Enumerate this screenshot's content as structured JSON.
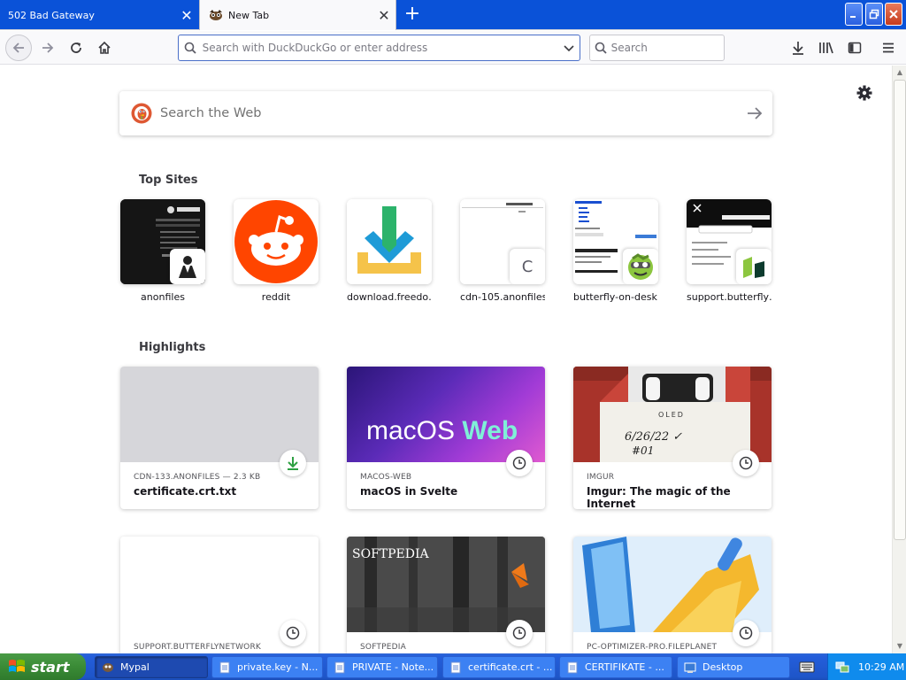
{
  "browser": {
    "tabs": [
      {
        "title": "502 Bad Gateway",
        "active": false
      },
      {
        "title": "New Tab",
        "active": true
      }
    ],
    "window_controls": {
      "minimize": "minimize",
      "maximize": "restore",
      "close": "close"
    }
  },
  "toolbar": {
    "url_placeholder": "Search with DuckDuckGo or enter address",
    "search_placeholder": "Search"
  },
  "newtab": {
    "web_search_placeholder": "Search the Web",
    "top_sites_title": "Top Sites",
    "top_sites": [
      {
        "label": "anonfiles"
      },
      {
        "label": "reddit"
      },
      {
        "label": "download.freedo…"
      },
      {
        "label": "cdn-105.anonfiles",
        "badge_letter": "C"
      },
      {
        "label": "butterfly-on-desk…"
      },
      {
        "label": "support.butterfly…"
      }
    ],
    "highlights_title": "Highlights",
    "highlights": [
      {
        "source": "CDN-133.ANONFILES — 2.3 KB",
        "title": "certificate.crt.txt",
        "icon": "download-icon",
        "image_text": ""
      },
      {
        "source": "MACOS-WEB",
        "title": "macOS in Svelte",
        "icon": "clock-icon",
        "image_text_1": "macOS",
        "image_text_2": "Web"
      },
      {
        "source": "IMGUR",
        "title": "Imgur: The magic of the Internet",
        "icon": "clock-icon",
        "image_text_1": "OLED",
        "image_text_2": "6/26/22 ✓",
        "image_text_3": "#01"
      },
      {
        "source": "SUPPORT.BUTTERFLYNETWORK",
        "title": "",
        "icon": "clock-icon"
      },
      {
        "source": "SOFTPEDIA",
        "title": "",
        "icon": "clock-icon",
        "image_text_1": "SOFTPEDIA"
      },
      {
        "source": "PC-OPTIMIZER-PRO.FILEPLANET",
        "title": "",
        "icon": "clock-icon"
      }
    ]
  },
  "taskbar": {
    "start_label": "start",
    "tasks": [
      {
        "label": "Mypal",
        "active": true
      },
      {
        "label": "private.key - N...",
        "active": false
      },
      {
        "label": "PRIVATE - Note...",
        "active": false
      },
      {
        "label": "certificate.crt - ...",
        "active": false
      },
      {
        "label": "CERTIFIKATE - ...",
        "active": false
      },
      {
        "label": "Desktop",
        "active": false
      }
    ],
    "clock": "10:29 AM"
  },
  "colors": {
    "titlebar": "#0a52d8",
    "taskbar": "#245edb",
    "start_green": "#3a8b36",
    "tray": "#0f8bed",
    "reddit": "#ff4500",
    "macos_purple": "#6a2fc7",
    "download_green": "#2ea043"
  }
}
